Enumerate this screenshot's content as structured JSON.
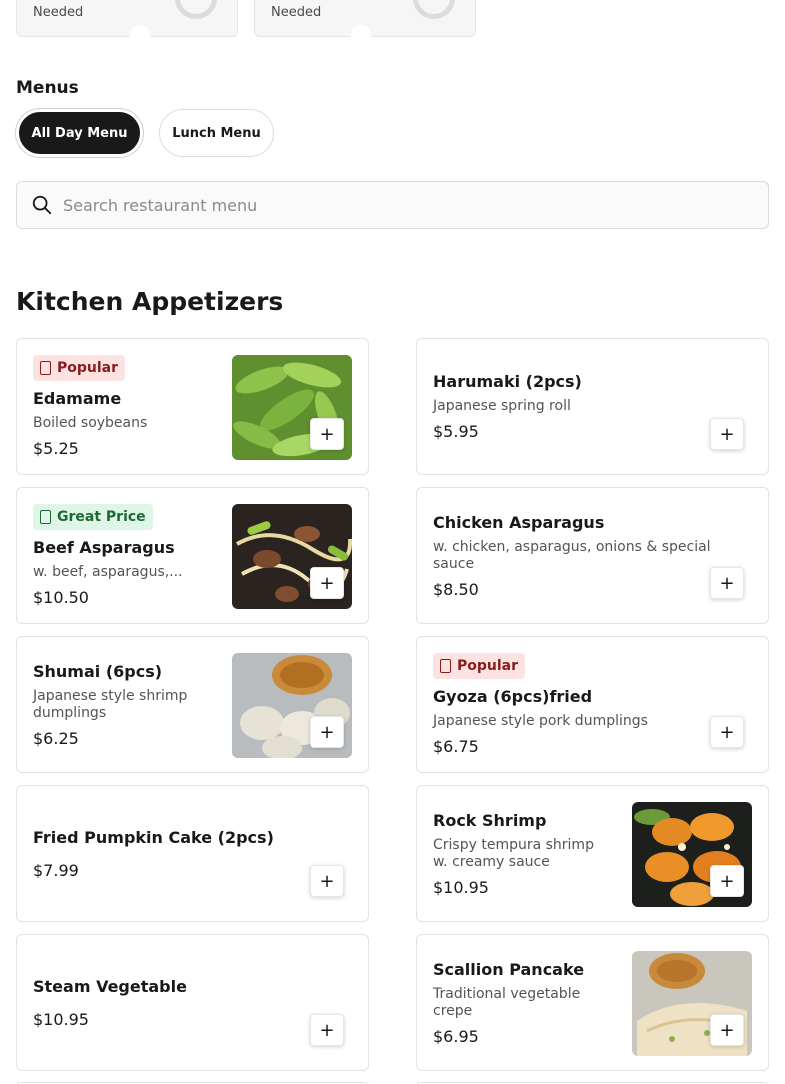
{
  "top_cards": [
    {
      "label": "Needed"
    },
    {
      "label": "Needed"
    }
  ],
  "menus": {
    "heading": "Menus",
    "tabs": [
      {
        "label": "All Day Menu",
        "active": true
      },
      {
        "label": "Lunch Menu",
        "active": false
      }
    ]
  },
  "search": {
    "placeholder": "Search restaurant menu",
    "icon": "search-icon"
  },
  "section": {
    "title": "Kitchen Appetizers"
  },
  "items": [
    {
      "name": "Edamame",
      "desc": "Boiled soybeans",
      "price": "$5.25",
      "badge": "Popular",
      "badge_type": "popular",
      "photo": "edamame"
    },
    {
      "name": "Harumaki (2pcs)",
      "desc": "Japanese spring roll",
      "price": "$5.95"
    },
    {
      "name": "Beef Asparagus",
      "desc": "w. beef, asparagus,...",
      "price": "$10.50",
      "badge": "Great Price",
      "badge_type": "great",
      "photo": "beef"
    },
    {
      "name": "Chicken Asparagus",
      "desc": "w. chicken, asparagus, onions & special sauce",
      "price": "$8.50"
    },
    {
      "name": "Shumai (6pcs)",
      "desc": "Japanese style shrimp dumplings",
      "price": "$6.25",
      "photo": "shumai"
    },
    {
      "name": "Gyoza (6pcs)fried",
      "desc": "Japanese style pork dumplings",
      "price": "$6.75",
      "badge": "Popular",
      "badge_type": "popular"
    },
    {
      "name": "Fried Pumpkin Cake (2pcs)",
      "price": "$7.99"
    },
    {
      "name": "Rock Shrimp",
      "desc": "Crispy tempura shrimp w. creamy sauce",
      "price": "$10.95",
      "photo": "shrimp"
    },
    {
      "name": "Steam Vegetable",
      "price": "$10.95"
    },
    {
      "name": "Scallion Pancake",
      "desc": "Traditional vegetable crepe",
      "price": "$6.95",
      "photo": "pancake"
    }
  ],
  "add_label": "+"
}
